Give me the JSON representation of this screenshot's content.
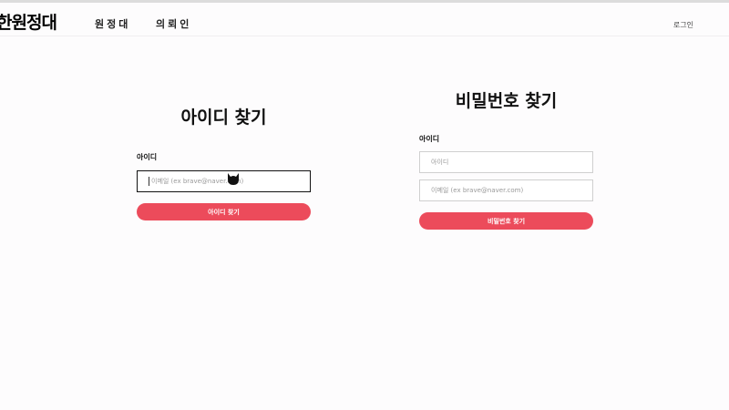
{
  "header": {
    "logo": "한원정대",
    "nav": [
      "원정대",
      "의뢰인"
    ],
    "login": "로그인"
  },
  "find_id": {
    "title": "아이디 찾기",
    "label": "아이디",
    "email_placeholder": "이메일 (ex brave@naver.com)",
    "button": "아이디 찾기"
  },
  "find_password": {
    "title": "비밀번호 찾기",
    "label": "아이디",
    "id_placeholder": "아이디",
    "email_placeholder": "이메일 (ex brave@naver.com)",
    "button": "비밀번호 찾기"
  },
  "colors": {
    "accent": "#ec4b5b",
    "background": "#fdfcfd"
  },
  "icons": {
    "cursor": "mouse-cursor-icon"
  }
}
